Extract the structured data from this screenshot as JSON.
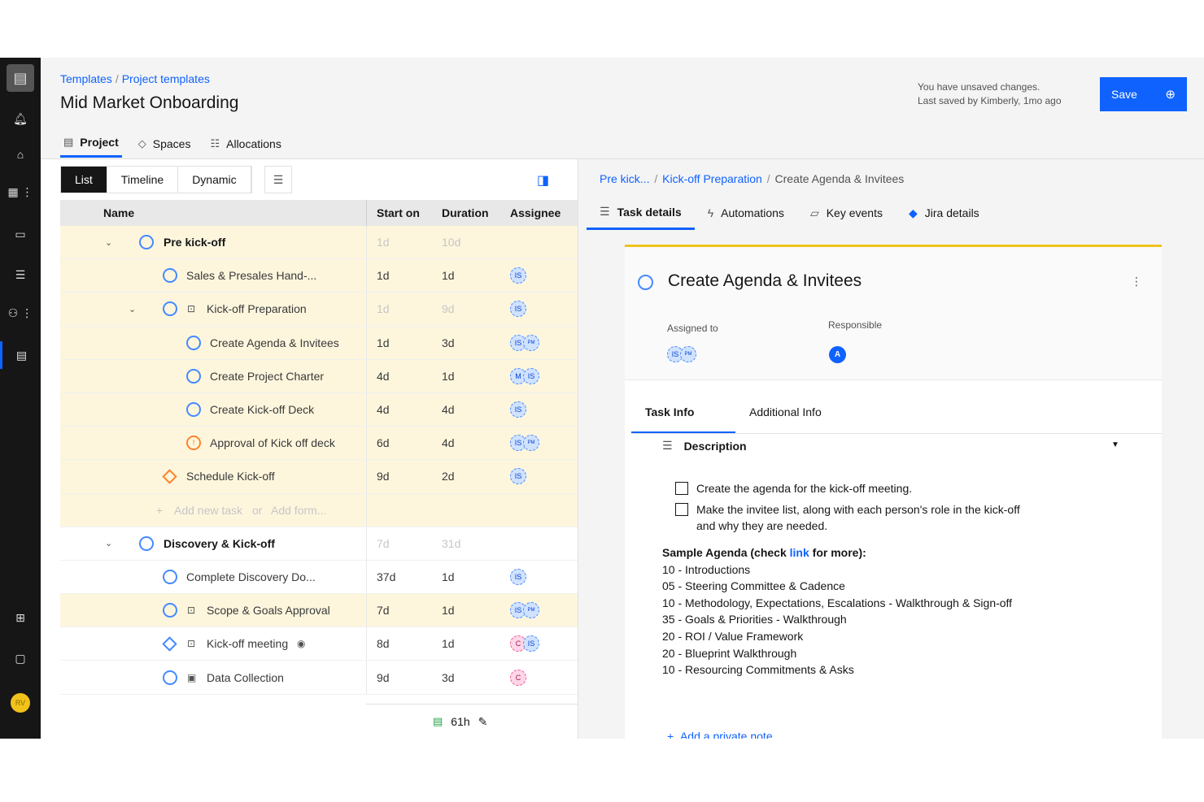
{
  "header": {
    "breadcrumb": [
      "Templates",
      "Project templates"
    ],
    "title": "Mid Market Onboarding",
    "tabs": [
      {
        "label": "Project",
        "icon": "table-icon"
      },
      {
        "label": "Spaces",
        "icon": "cube-icon"
      },
      {
        "label": "Allocations",
        "icon": "allocations-icon"
      }
    ],
    "unsaved_line1": "You have unsaved changes.",
    "unsaved_line2": "Last saved by Kimberly, 1mo ago",
    "save_label": "Save"
  },
  "rail": {
    "avatar_initials": "RV"
  },
  "views": [
    "List",
    "Timeline",
    "Dynamic"
  ],
  "table": {
    "columns": [
      "Name",
      "Start on",
      "Duration",
      "Assignee"
    ],
    "rows": [
      {
        "name": "Pre kick-off",
        "start": "1d",
        "duration": "10d"
      },
      {
        "name": "Sales & Presales Hand-...",
        "start": "1d",
        "duration": "1d",
        "assignee": [
          "IS"
        ]
      },
      {
        "name": "Kick-off Preparation",
        "start": "1d",
        "duration": "9d",
        "assignee": [
          "IS"
        ]
      },
      {
        "name": "Create Agenda & Invitees",
        "start": "1d",
        "duration": "3d",
        "assignee": [
          "IS",
          "PM"
        ]
      },
      {
        "name": "Create Project Charter",
        "start": "4d",
        "duration": "1d",
        "assignee": [
          "M",
          "IS"
        ]
      },
      {
        "name": "Create Kick-off Deck",
        "start": "4d",
        "duration": "4d",
        "assignee": [
          "IS"
        ]
      },
      {
        "name": "Approval of Kick off deck",
        "start": "6d",
        "duration": "4d",
        "assignee": [
          "IS",
          "PM"
        ]
      },
      {
        "name": "Schedule Kick-off",
        "start": "9d",
        "duration": "2d",
        "assignee": [
          "IS"
        ]
      },
      {
        "name": "Discovery & Kick-off",
        "start": "7d",
        "duration": "31d"
      },
      {
        "name": "Complete Discovery Do...",
        "start": "37d",
        "duration": "1d",
        "assignee": [
          "IS"
        ]
      },
      {
        "name": "Scope & Goals Approval",
        "start": "7d",
        "duration": "1d",
        "assignee": [
          "IS",
          "PM"
        ]
      },
      {
        "name": "Kick-off meeting",
        "start": "8d",
        "duration": "1d",
        "assignee": [
          "C",
          "IS"
        ]
      },
      {
        "name": "Data Collection",
        "start": "9d",
        "duration": "3d",
        "assignee": [
          "C"
        ]
      }
    ],
    "add_task": "Add new task",
    "or": "or",
    "add_form": "Add form...",
    "total_hours": "61h"
  },
  "detail": {
    "breadcrumb": [
      "Pre kick...",
      "Kick-off Preparation",
      "Create Agenda & Invitees"
    ],
    "tabs": [
      "Task details",
      "Automations",
      "Key events",
      "Jira details"
    ],
    "task_title": "Create Agenda & Invitees",
    "assigned_label": "Assigned to",
    "assigned": [
      "IS",
      "PM"
    ],
    "responsible_label": "Responsible",
    "responsible": "A",
    "inner_tabs": [
      "Task Info",
      "Additional Info"
    ],
    "description_label": "Description",
    "checklist": [
      "Create the agenda for the kick-off meeting.",
      "Make the invitee list, along with each person's role in the kick-off and why they are needed."
    ],
    "agenda_heading_pre": "Sample Agenda (check ",
    "agenda_link": "link",
    "agenda_heading_post": " for more):",
    "agenda_items": [
      "10 - Introductions",
      "05 - Steering Committee & Cadence",
      "10 - Methodology, Expectations, Escalations - Walkthrough & Sign-off",
      "35 - Goals & Priorities - Walkthrough",
      "20 - ROI / Value Framework",
      "20 - Blueprint Walkthrough",
      "10 - Resourcing Commitments & Asks"
    ],
    "add_note": "Add a private note"
  },
  "colors": {
    "accent": "#0f62fe",
    "highlight": "#fdf6dd",
    "rail": "#161616",
    "warning": "#f1c21b"
  }
}
